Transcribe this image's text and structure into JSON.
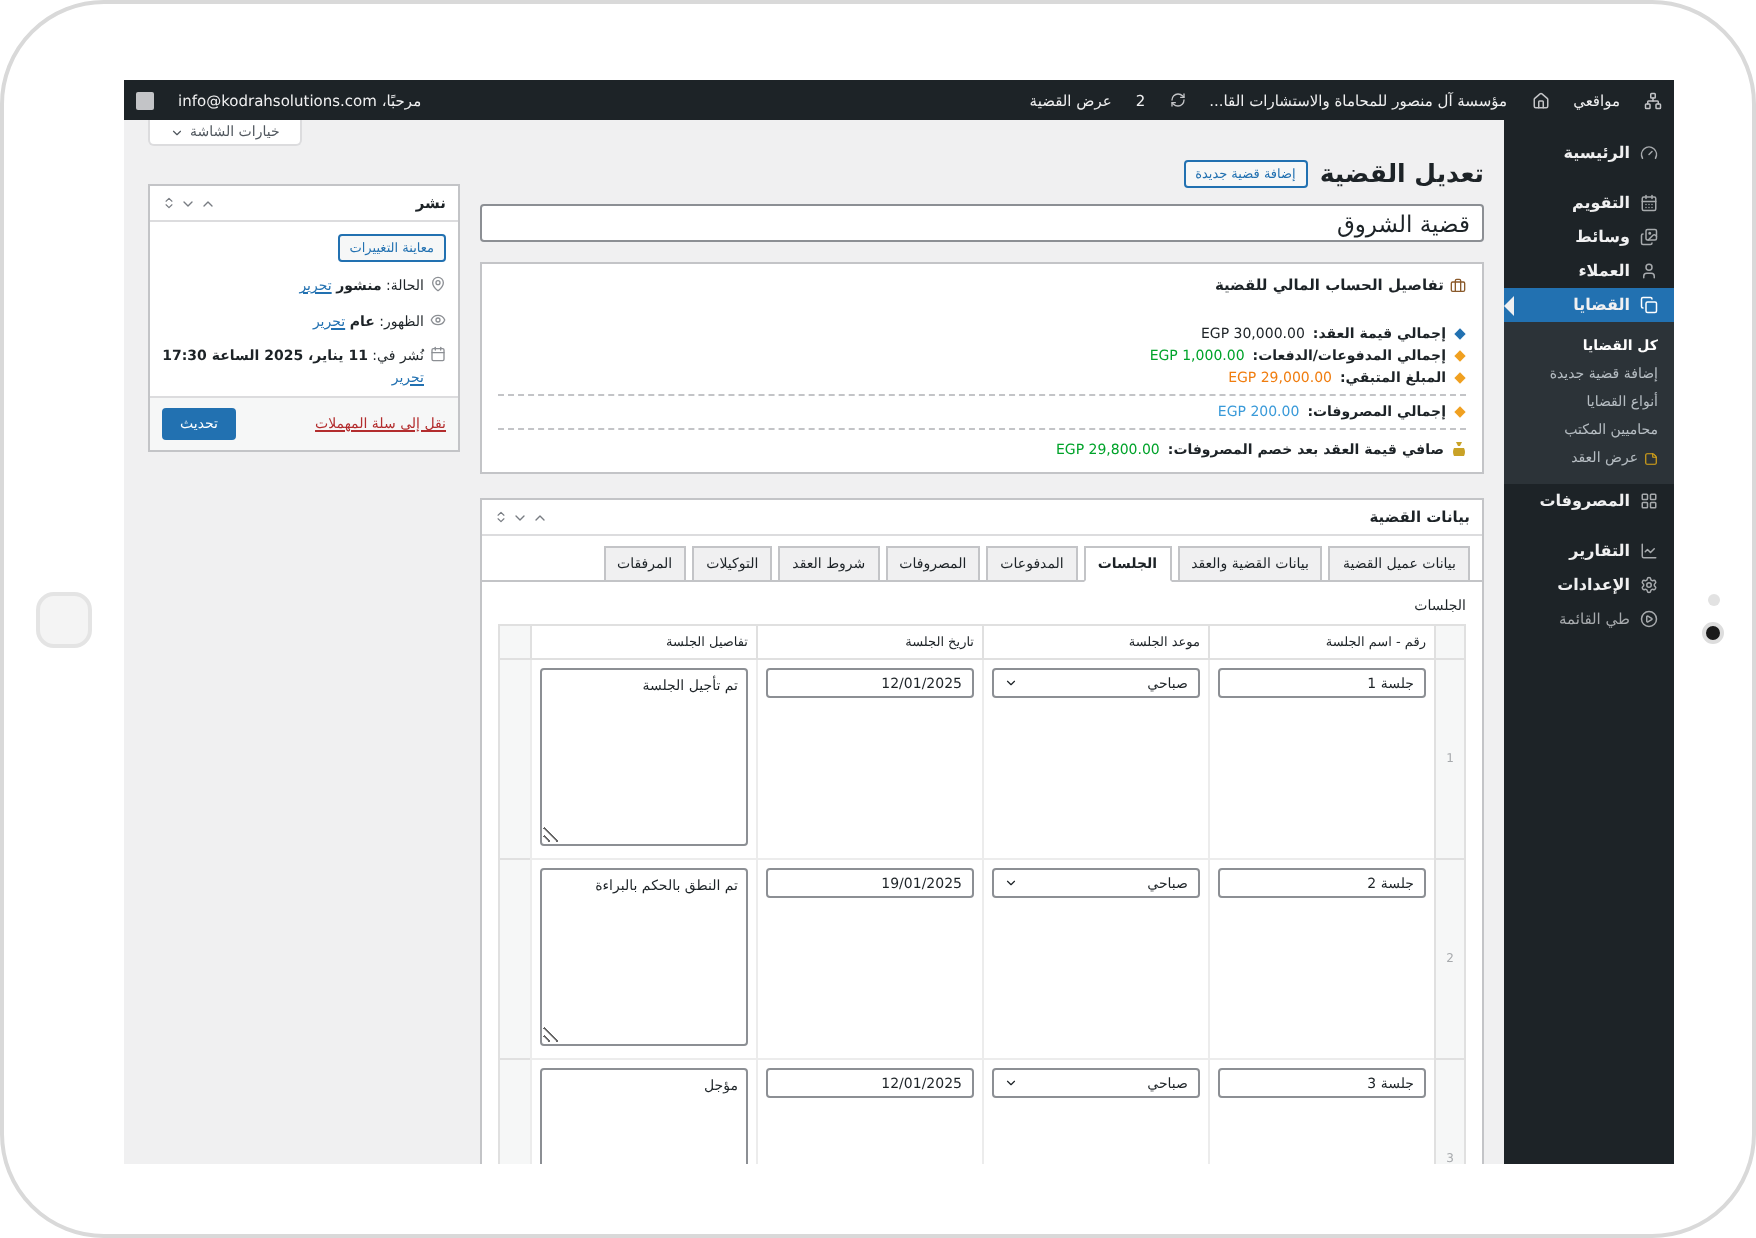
{
  "admin_bar": {
    "my_sites": "مواقعي",
    "site_title": "مؤسسة آل منصور للمحاماة والاستشارات القا...",
    "updates": "2",
    "view_link": "عرض القضية",
    "greeting": "مرحبًا، info@kodrahsolutions.com"
  },
  "sidebar": {
    "items": [
      {
        "label": "الرئيسية",
        "selected": false
      },
      {
        "label": "التقويم",
        "selected": false
      },
      {
        "label": "وسائط",
        "selected": false
      },
      {
        "label": "العملاء",
        "selected": false
      },
      {
        "label": "القضايا",
        "selected": true,
        "children": [
          {
            "label": "كل القضايا",
            "selected": true
          },
          {
            "label": "إضافة قضية جديدة",
            "selected": false
          },
          {
            "label": "أنواع القضايا",
            "selected": false
          },
          {
            "label": "محاميين المكتب",
            "selected": false
          },
          {
            "label": "عرض العقد",
            "selected": false
          }
        ]
      },
      {
        "label": "المصروفات",
        "selected": false
      },
      {
        "label": "التقارير",
        "selected": false
      },
      {
        "label": "الإعدادات",
        "selected": false
      }
    ],
    "collapse": "طي القائمة"
  },
  "screen_options": "خيارات الشاشة",
  "page_title": "تعديل القضية",
  "add_new_button": "إضافة قضية جديدة",
  "title_field": "قضية الشروق",
  "finance_box": {
    "title": "تفاصيل الحساب المالي للقضية",
    "groups": [
      {
        "items": [
          {
            "marker": {
              "color": "#2271b1"
            },
            "label": "إجمالي قيمة العقد:",
            "value": {
              "text": "EGP 30,000.00",
              "color": "#1d2327"
            }
          },
          {
            "marker": {
              "color": "#f0a020"
            },
            "label": "إجمالي المدفوعات/الدفعات:",
            "value": {
              "text": "EGP 1,000.00",
              "color": "#00a32a"
            }
          },
          {
            "marker": {
              "color": "#f0a020"
            },
            "label": "المبلغ المتبقي:",
            "value": {
              "text": "EGP 29,000.00",
              "color": "#f07d0f"
            }
          }
        ]
      },
      {
        "items": [
          {
            "marker": {
              "color": "#f0a020"
            },
            "label": "إجمالي المصروفات:",
            "value": {
              "text": "EGP 200.00",
              "color": "#3a9ad9"
            }
          }
        ]
      }
    ],
    "net": {
      "label": "صافي قيمة العقد بعد خصم المصروفات:",
      "value": {
        "text": "EGP 29,800.00",
        "color": "#00a32a"
      }
    }
  },
  "publish_box": {
    "title": "نشر",
    "preview_button": "معاينة التغييرات",
    "rows": [
      {
        "text": "الحالة: **منشور**",
        "link": "تحرير"
      },
      {
        "text": "الظهور: **عام**",
        "link": "تحرير"
      },
      {
        "text": "نُشر في: **11 يناير، 2025 الساعة 17:30**",
        "link": "تحرير"
      }
    ],
    "trash_link": "نقل إلى سلة المهملات",
    "update_button": "تحديث"
  },
  "case_box": {
    "title": "بيانات القضية",
    "tabs": [
      {
        "label": "بيانات عميل القضية",
        "selected": false
      },
      {
        "label": "بيانات القضية والعقد",
        "selected": false
      },
      {
        "label": "الجلسات",
        "selected": true
      },
      {
        "label": "المدفوعات",
        "selected": false
      },
      {
        "label": "المصروفات",
        "selected": false
      },
      {
        "label": "شروط العقد",
        "selected": false
      },
      {
        "label": "التوكيلات",
        "selected": false
      },
      {
        "label": "المرفقات",
        "selected": false
      }
    ],
    "section_label": "الجلسات",
    "table": {
      "columns": [
        "رقم - اسم الجلسة",
        "موعد الجلسة",
        "تاريخ الجلسة",
        "تفاصيل الجلسة"
      ],
      "rows": [
        {
          "index": "1",
          "name": "جلسة 1",
          "time": "صباحي",
          "date": "12/01/2025",
          "details": "تم تأجيل الجلسة"
        },
        {
          "index": "2",
          "name": "جلسة 2",
          "time": "صباحي",
          "date": "19/01/2025",
          "details": "تم النطق بالحكم بالبراءة"
        },
        {
          "index": "3",
          "name": "جلسة 3",
          "time": "صباحي",
          "date": "12/01/2025",
          "details": "مؤجل"
        }
      ]
    }
  }
}
